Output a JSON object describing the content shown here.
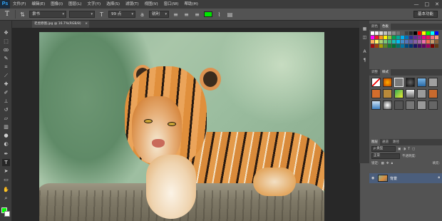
{
  "app": {
    "logo": "Ps"
  },
  "menu": [
    "文件(F)",
    "编辑(E)",
    "图像(I)",
    "图层(L)",
    "文字(Y)",
    "选择(S)",
    "滤镜(T)",
    "视图(V)",
    "窗口(W)",
    "帮助(H)"
  ],
  "window_controls": [
    "—",
    "□",
    "✕"
  ],
  "options": {
    "font_family": "隶书",
    "font_size": "99 点",
    "antialias": "锐利",
    "text_color": "#00e600",
    "workspace": "基本功能"
  },
  "document": {
    "tab_title": "老虎原图.jpg @ 16.7%(RGB/8)",
    "close": "×"
  },
  "colors": {
    "foreground": "#00ff00",
    "background": "#ffffff"
  },
  "panels": {
    "swatch_tabs": [
      "颜色",
      "色板"
    ],
    "style_tabs": [
      "调整",
      "样式"
    ],
    "layers_tabs": [
      "图层",
      "通道",
      "路径"
    ],
    "kind_label": "ρ 类型",
    "blend_mode": "正常",
    "opacity_label": "不透明度:",
    "lock_label": "锁定:",
    "fill_label": "填充:",
    "layer_name": "背景"
  },
  "swatch_colors": [
    "#ffffff",
    "#f2f2f2",
    "#d9d9d9",
    "#bfbfbf",
    "#a6a6a6",
    "#8c8c8c",
    "#737373",
    "#595959",
    "#404040",
    "#262626",
    "#000000",
    "#ff0000",
    "#ffff00",
    "#00ff00",
    "#00ffff",
    "#0000ff",
    "#ff00ff",
    "#ed1c24",
    "#f7941d",
    "#fff200",
    "#8dc63f",
    "#00a651",
    "#00a99d",
    "#00aeef",
    "#0072bc",
    "#2e3192",
    "#662d91",
    "#92278f",
    "#ec008c",
    "#ed145b",
    "#f26d7d",
    "#f69679",
    "#fbaf5d",
    "#fff468",
    "#acd372",
    "#7cc576",
    "#3bb878",
    "#1abbb4",
    "#00bff3",
    "#438ccb",
    "#5574b9",
    "#605ca8",
    "#855fa8",
    "#a763a8",
    "#f06ea9",
    "#f26c4f",
    "#c69c6d",
    "#8c6239",
    "#9e0b0f",
    "#a0410d",
    "#aba000",
    "#598527",
    "#197b30",
    "#007236",
    "#00746b",
    "#0076a3",
    "#004a80",
    "#003471",
    "#1b1464",
    "#440e62",
    "#630460",
    "#9e005d",
    "#790000",
    "#603913"
  ]
}
